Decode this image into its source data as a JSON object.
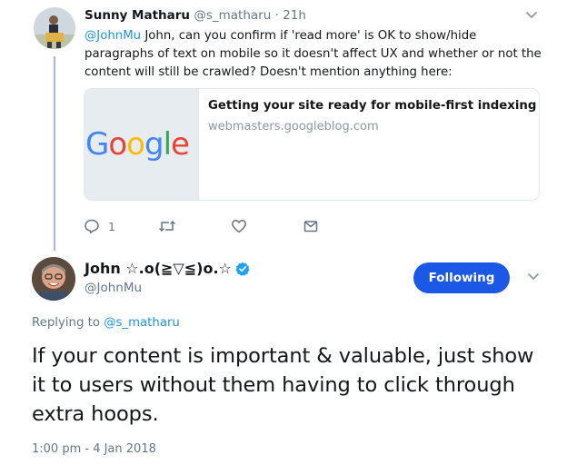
{
  "parent_tweet": {
    "author_name": "Sunny Matharu",
    "author_handle": "@s_matharu",
    "separator": "·",
    "time": "21h",
    "mention": "@JohnMu",
    "text": " John, can you confirm if 'read more' is OK to show/hide paragraphs of text on mobile so it doesn't affect UX and whether or not the content will still be crawled? Doesn't mention anything here:",
    "card": {
      "image_label": "Google",
      "title": "Getting your site ready for mobile-first indexing",
      "domain": "webmasters.googleblog.com"
    },
    "actions": {
      "reply_icon": "reply-icon",
      "reply_count": "1",
      "retweet_icon": "retweet-icon",
      "like_icon": "heart-icon",
      "dm_icon": "envelope-icon"
    }
  },
  "main_tweet": {
    "author_name": "John ☆.o(≧▽≦)o.☆",
    "author_handle": "@JohnMu",
    "verified_icon": "verified-badge-icon",
    "follow_label": "Following",
    "replying_prefix": "Replying to ",
    "replying_handle": "@s_matharu",
    "text": "If your content is important & valuable, just show it to users without them having to click through extra hoops.",
    "timestamp": "1:00 pm - 4 Jan 2018"
  },
  "colors": {
    "accent_link": "#1b95e0",
    "follow_button": "#1c58e6",
    "muted_text": "#657786",
    "thread_line": "#a6b5f2"
  }
}
